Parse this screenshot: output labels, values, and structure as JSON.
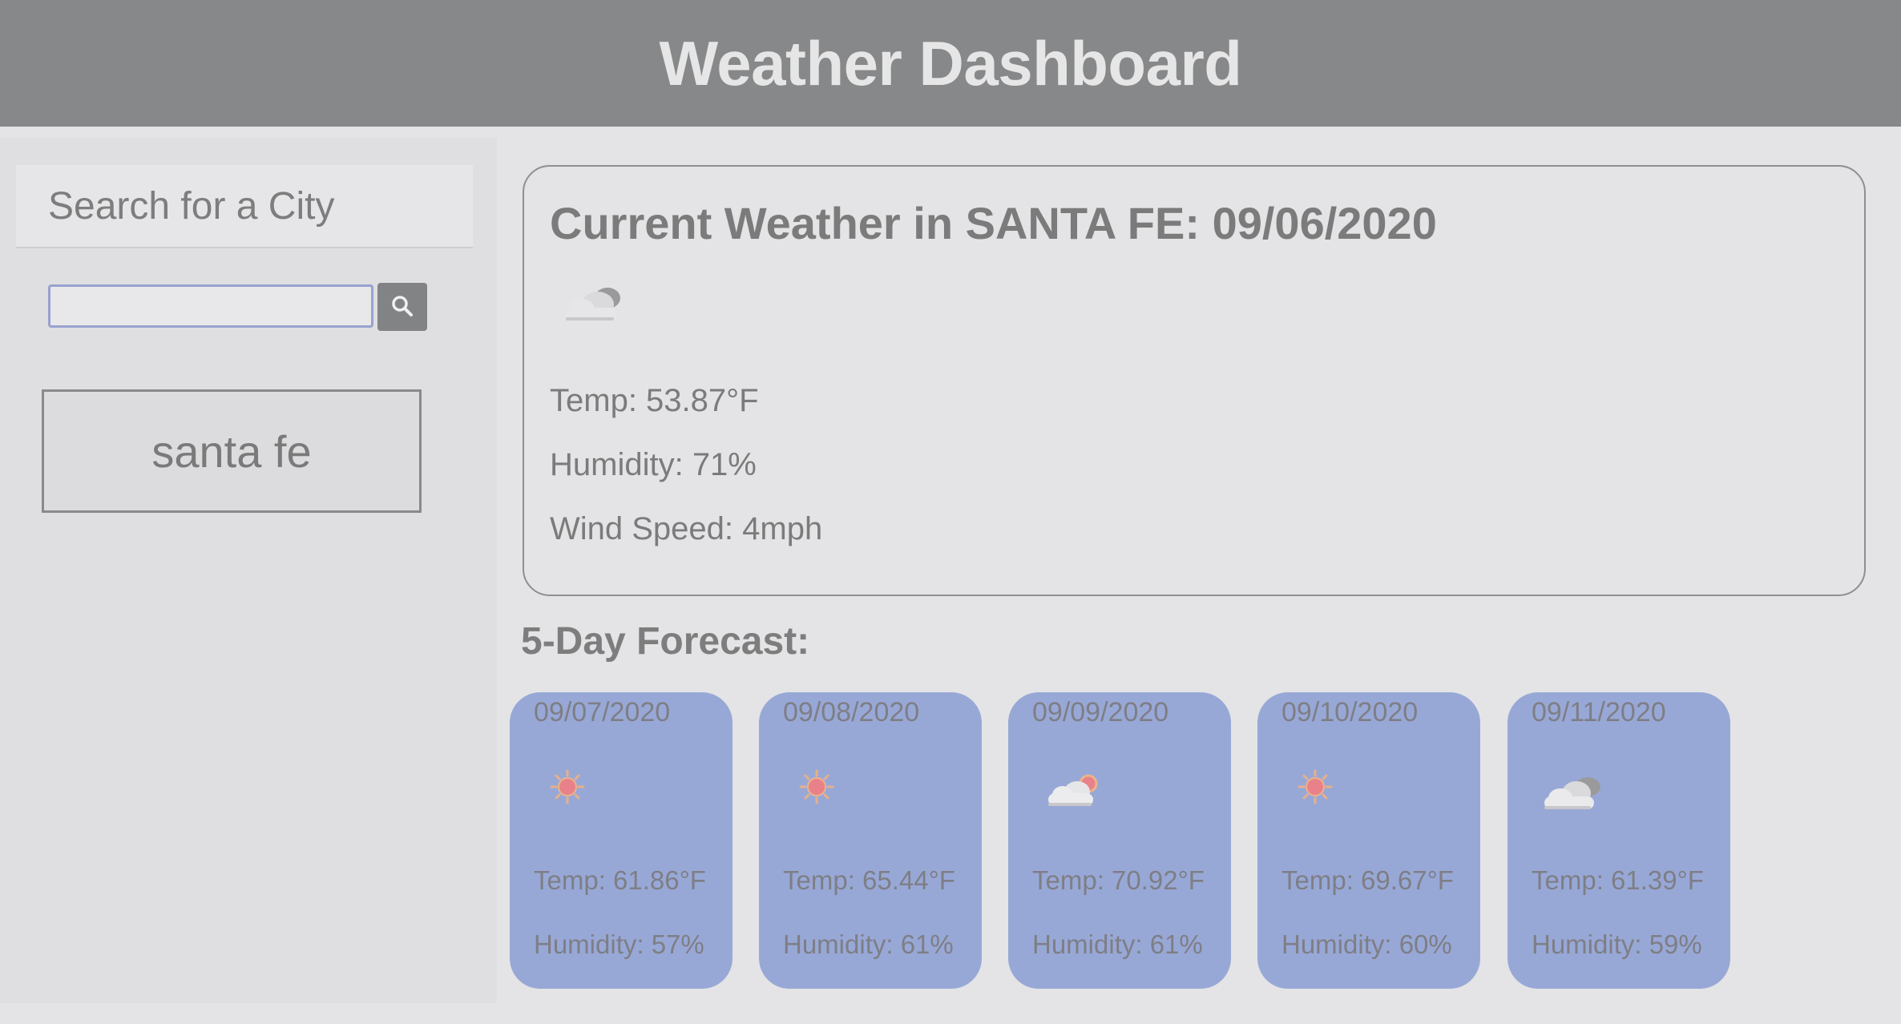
{
  "header": {
    "title": "Weather Dashboard"
  },
  "sidebar": {
    "heading": "Search for a City",
    "search": {
      "value": "",
      "placeholder": ""
    },
    "history": [
      "santa fe"
    ]
  },
  "current": {
    "title": "Current Weather in SANTA FE: 09/06/2020",
    "icon": "cloud-icon",
    "temp": "Temp: 53.87°F",
    "humidity": "Humidity: 71%",
    "wind": "Wind Speed: 4mph"
  },
  "forecast": {
    "title": "5-Day Forecast:",
    "days": [
      {
        "date": "09/07/2020",
        "icon": "sun-icon",
        "temp": "Temp: 61.86°F",
        "humidity": "Humidity: 57%"
      },
      {
        "date": "09/08/2020",
        "icon": "sun-icon",
        "temp": "Temp: 65.44°F",
        "humidity": "Humidity: 61%"
      },
      {
        "date": "09/09/2020",
        "icon": "partly-cloudy-icon",
        "temp": "Temp: 70.92°F",
        "humidity": "Humidity: 61%"
      },
      {
        "date": "09/10/2020",
        "icon": "sun-icon",
        "temp": "Temp: 69.67°F",
        "humidity": "Humidity: 60%"
      },
      {
        "date": "09/11/2020",
        "icon": "cloud-icon",
        "temp": "Temp: 61.39°F",
        "humidity": "Humidity: 59%"
      }
    ]
  },
  "colors": {
    "header_bg": "#87888a",
    "card_bg": "#98a8d6",
    "page_bg": "#e4e4e6"
  }
}
